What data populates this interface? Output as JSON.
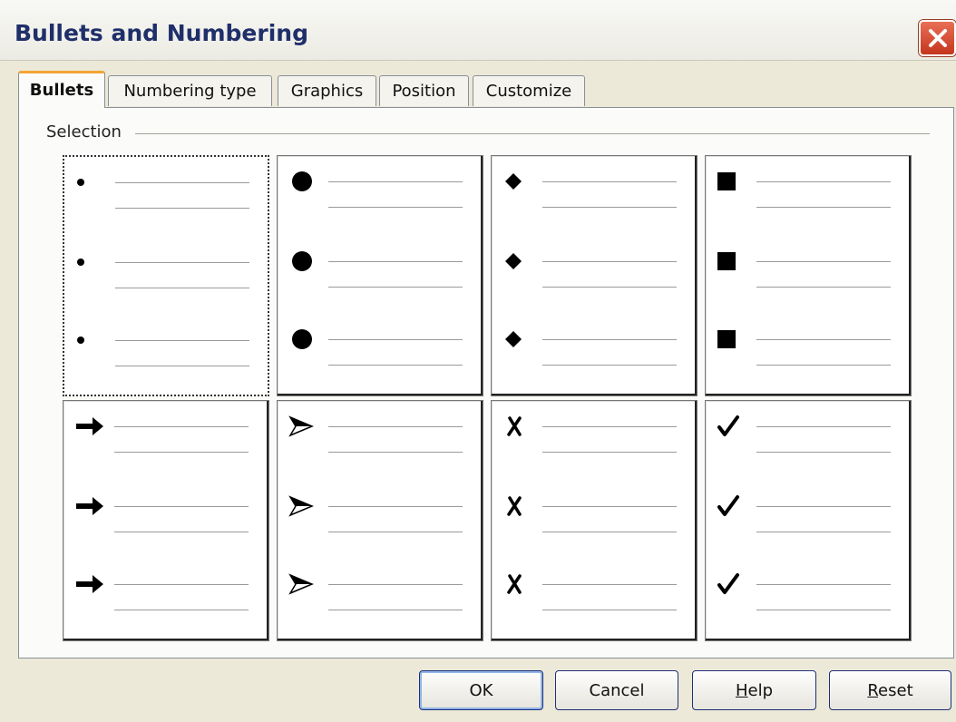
{
  "window": {
    "title": "Bullets and Numbering",
    "close_icon": "close-x-icon"
  },
  "tabs": [
    {
      "label": "Bullets",
      "active": true
    },
    {
      "label": "Numbering type",
      "active": false
    },
    {
      "label": "Graphics",
      "active": false
    },
    {
      "label": "Position",
      "active": false
    },
    {
      "label": "Customize",
      "active": false
    }
  ],
  "selection": {
    "label": "Selection",
    "styles": [
      {
        "name": "small-dot",
        "icon": "small-dot-bullet-icon",
        "selected": true
      },
      {
        "name": "large-dot",
        "icon": "large-dot-bullet-icon",
        "selected": false
      },
      {
        "name": "diamond",
        "icon": "diamond-bullet-icon",
        "selected": false
      },
      {
        "name": "square",
        "icon": "square-bullet-icon",
        "selected": false
      },
      {
        "name": "arrow",
        "icon": "arrow-bullet-icon",
        "selected": false
      },
      {
        "name": "arrowhead",
        "icon": "arrowhead-bullet-icon",
        "selected": false
      },
      {
        "name": "cross",
        "icon": "cross-mark-bullet-icon",
        "selected": false
      },
      {
        "name": "check",
        "icon": "check-mark-bullet-icon",
        "selected": false
      }
    ]
  },
  "buttons": {
    "ok": "OK",
    "cancel": "Cancel",
    "help_first": "H",
    "help_rest": "elp",
    "reset_first": "R",
    "reset_rest": "eset"
  }
}
